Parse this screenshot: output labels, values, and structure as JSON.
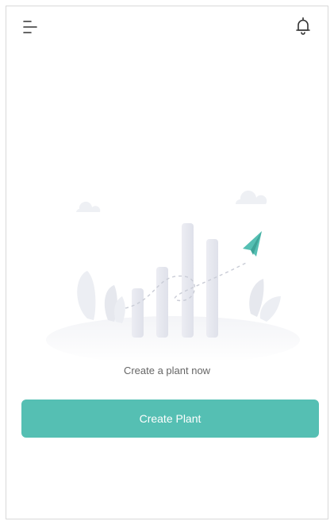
{
  "header": {
    "menu_icon": "menu-icon",
    "notification_icon": "bell-icon"
  },
  "empty_state": {
    "illustration": "plants-chart-illustration",
    "caption": "Create a plant now"
  },
  "actions": {
    "create_plant_label": "Create Plant"
  },
  "colors": {
    "accent": "#55bfb3",
    "caption_text": "#666666",
    "icon_stroke": "#333333"
  }
}
